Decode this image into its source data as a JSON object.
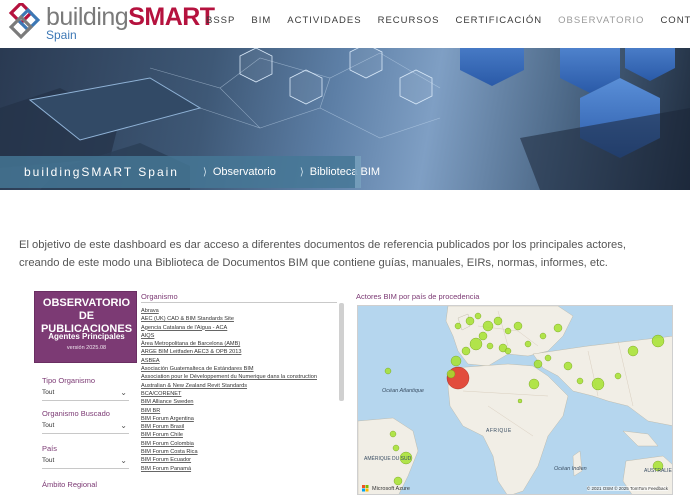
{
  "brand": {
    "name_part1": "building",
    "name_part2": "SMART",
    "subtitle": "Spain"
  },
  "nav": {
    "items": [
      {
        "label": "BSSP"
      },
      {
        "label": "BIM"
      },
      {
        "label": "ACTIVIDADES"
      },
      {
        "label": "RECURSOS"
      },
      {
        "label": "CERTIFICACIÓN"
      },
      {
        "label": "OBSERVATORIO"
      },
      {
        "label": "CONTACTO"
      }
    ],
    "active": "OBSERVATORIO"
  },
  "breadcrumb": {
    "home": "buildingSMART Spain",
    "items": [
      "Observatorio",
      "Biblioteca BIM"
    ]
  },
  "intro": "El objetivo de este dashboard es dar acceso a diferentes documentos de referencia publicados por los principales actores, creando de este modo una Biblioteca de Documentos BIM que contiene guías, manuales, EIRs, normas, informes, etc.",
  "dashboard": {
    "title_line1": "OBSERVATORIO DE",
    "title_line2": "PUBLICACIONES",
    "subtitle": "Agentes Principales",
    "version": "versión 2025.08",
    "filters": [
      {
        "label": "Tipo Organismo",
        "value": "Tout"
      },
      {
        "label": "Organismo Buscado",
        "value": "Tout"
      },
      {
        "label": "País",
        "value": "Tout"
      },
      {
        "label": "Ámbito Regional",
        "value": ""
      }
    ],
    "list_header": "Organismo",
    "organisms": [
      "Abrava",
      "AEC (UK) CAD & BIM Standards Site",
      "Agencia Catalana de l'Aigua - ACA",
      "AIQS",
      "Àrea Metropolitana de Barcelona (AMB)",
      "ARGE BIM Leitfaden AEC3 & OPB 2013",
      "ASBEA",
      "Asociación Guatemalteca de Estándares BIM",
      "Association pour le Développement du Numerique dans la construction",
      "Australian & New Zealand Revit Standards",
      "BCA/CORENET",
      "BIM Alliance Sweden",
      "BIM BR",
      "BIM Forum Argentina",
      "BIM Forum Brasil",
      "BIM Forum Chile",
      "BIM Forum Colombia",
      "BIM Forum Costa Rica",
      "BIM Forum Ecuador",
      "BIM Forum Panamá"
    ],
    "map_title": "Actores BIM por país de procedencia",
    "map_labels": {
      "ocean_atlantic": "Océan Atlantique",
      "ocean_indian": "Océan Indien",
      "africa": "AFRIQUE",
      "america": "AMÉRIQUE DU SUD",
      "australia": "AUSTRALIE"
    },
    "map_credit": "© 2021 OSM  © 2025 TomTom  Feedback",
    "map_provider": "Microsoft Azure",
    "colors": {
      "accent": "#7c3a74",
      "bubble": "#a6e22e",
      "bubble_major": "#e03a2a"
    }
  }
}
